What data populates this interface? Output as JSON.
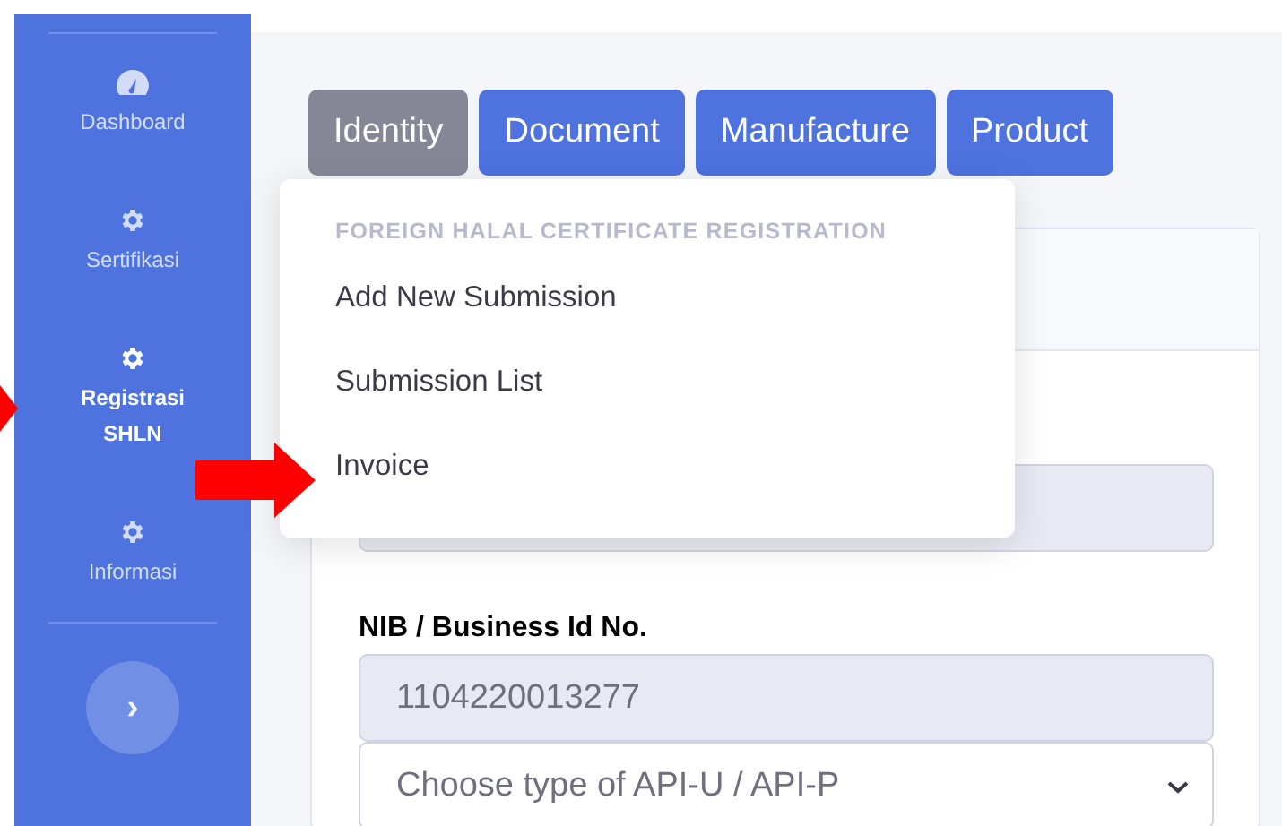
{
  "sidebar": {
    "items": [
      {
        "label": "Dashboard",
        "kind": "gauge",
        "selected": false
      },
      {
        "label": "Sertifikasi",
        "kind": "gear",
        "selected": false
      },
      {
        "label": "Registrasi SHLN",
        "kind": "gear",
        "selected": true
      },
      {
        "label": "Informasi",
        "kind": "gear",
        "selected": false
      }
    ],
    "toggle": "›"
  },
  "tabs": [
    {
      "label": "Identity",
      "selected": true
    },
    {
      "label": "Document",
      "selected": false
    },
    {
      "label": "Manufacture",
      "selected": false
    },
    {
      "label": "Product",
      "selected": false
    }
  ],
  "menu": {
    "header": "FOREIGN HALAL CERTIFICATE REGISTRATION",
    "items": [
      "Add New Submission",
      "Submission List",
      "Invoice"
    ]
  },
  "form": {
    "fields": [
      {
        "kind": "input"
      },
      {
        "kind": "input",
        "label": "NIB / Business Id No.",
        "value": "1104220013277"
      },
      {
        "kind": "select",
        "value": "Choose type of API-U / API-P"
      }
    ]
  }
}
